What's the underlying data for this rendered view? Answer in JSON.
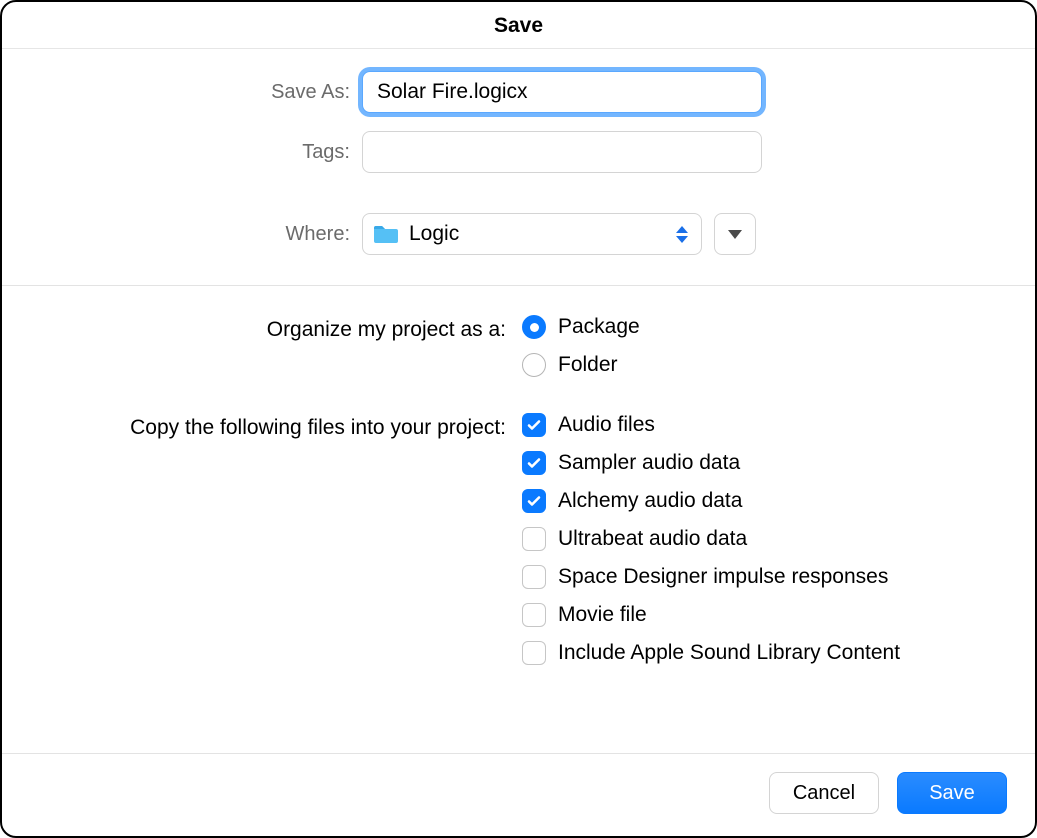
{
  "title": "Save",
  "saveAs": {
    "label": "Save As:",
    "value": "Solar Fire.logicx"
  },
  "tags": {
    "label": "Tags:",
    "value": ""
  },
  "where": {
    "label": "Where:",
    "value": "Logic"
  },
  "organize": {
    "label": "Organize my project as a:",
    "options": [
      {
        "label": "Package",
        "selected": true
      },
      {
        "label": "Folder",
        "selected": false
      }
    ]
  },
  "copy": {
    "label": "Copy the following files into your project:",
    "options": [
      {
        "label": "Audio files",
        "checked": true
      },
      {
        "label": "Sampler audio data",
        "checked": true
      },
      {
        "label": "Alchemy audio data",
        "checked": true
      },
      {
        "label": "Ultrabeat audio data",
        "checked": false
      },
      {
        "label": "Space Designer impulse responses",
        "checked": false
      },
      {
        "label": "Movie file",
        "checked": false
      },
      {
        "label": "Include Apple Sound Library Content",
        "checked": false
      }
    ]
  },
  "buttons": {
    "cancel": "Cancel",
    "save": "Save"
  }
}
